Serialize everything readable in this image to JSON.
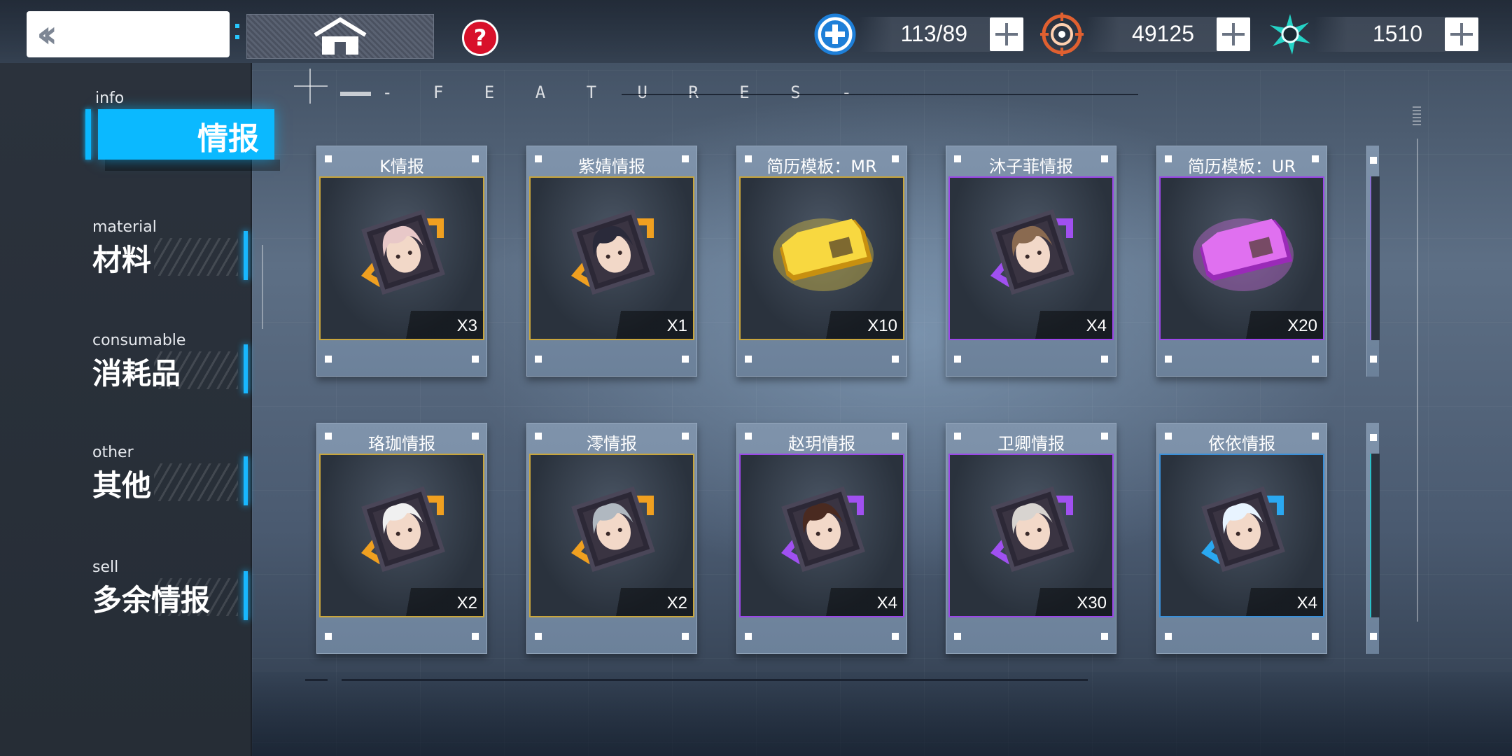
{
  "topbar": {
    "back_icon": "double-chevron-left-icon",
    "home_icon": "home-icon",
    "help_label": "?",
    "resources": [
      {
        "icon": "medical-plus-icon",
        "value": "113/89",
        "accent": "#1e7fd8"
      },
      {
        "icon": "target-reticle-icon",
        "value": "49125",
        "accent": "#e06030"
      },
      {
        "icon": "energy-burst-icon",
        "value": "1510",
        "accent": "#24d3c6"
      }
    ]
  },
  "sidebar": {
    "items": [
      {
        "en": "info",
        "zh": "情报",
        "active": true
      },
      {
        "en": "material",
        "zh": "材料",
        "active": false
      },
      {
        "en": "consumable",
        "zh": "消耗品",
        "active": false
      },
      {
        "en": "other",
        "zh": "其他",
        "active": false
      },
      {
        "en": "sell",
        "zh": "多余情报",
        "active": false
      }
    ],
    "accent": "#0bb9ff"
  },
  "header": {
    "label": "- F E A T U R E S -"
  },
  "items": [
    {
      "name": "K情报",
      "qty": "X3",
      "rarity": "gold",
      "kind": "portrait",
      "corner": "#f0a020",
      "hair": "#e8c8c8"
    },
    {
      "name": "紫婧情报",
      "qty": "X1",
      "rarity": "gold",
      "kind": "portrait",
      "corner": "#f0a020",
      "hair": "#2a2a3a"
    },
    {
      "name": "简历模板：MR",
      "qty": "X10",
      "rarity": "gold",
      "kind": "template-gold",
      "corner": "#e8c020",
      "hair": ""
    },
    {
      "name": "沐子菲情报",
      "qty": "X4",
      "rarity": "purple",
      "kind": "portrait",
      "corner": "#a050f0",
      "hair": "#8a6a50"
    },
    {
      "name": "简历模板：UR",
      "qty": "X20",
      "rarity": "purple",
      "kind": "template-purple",
      "corner": "#c040e0",
      "hair": ""
    },
    {
      "name": "珞珈情报",
      "qty": "X2",
      "rarity": "gold",
      "kind": "portrait",
      "corner": "#f0a020",
      "hair": "#f0f0f0"
    },
    {
      "name": "澪情报",
      "qty": "X2",
      "rarity": "gold",
      "kind": "portrait",
      "corner": "#f0a020",
      "hair": "#b0b8c0"
    },
    {
      "name": "赵玥情报",
      "qty": "X4",
      "rarity": "purple",
      "kind": "portrait",
      "corner": "#a050f0",
      "hair": "#4a2a20"
    },
    {
      "name": "卫卿情报",
      "qty": "X30",
      "rarity": "purple",
      "kind": "portrait",
      "corner": "#a050f0",
      "hair": "#d8d4d0"
    },
    {
      "name": "依依情报",
      "qty": "X4",
      "rarity": "blue",
      "kind": "portrait",
      "corner": "#2aa8f0",
      "hair": "#e8f4ff"
    }
  ]
}
